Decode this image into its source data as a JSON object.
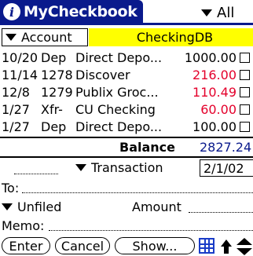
{
  "title_bar": {
    "app_title": "MyCheckbook",
    "view_menu_label": "All"
  },
  "account": {
    "trigger_label": "Account",
    "name": "CheckingDB",
    "name_bg": "#ffff00"
  },
  "register": {
    "rows": [
      {
        "date": "10/20",
        "num": "Dep",
        "desc": "Direct Depo...",
        "amount": "1000.00",
        "amount_color": "black"
      },
      {
        "date": "11/14",
        "num": "1278",
        "desc": "Discover",
        "amount": "216.00",
        "amount_color": "red"
      },
      {
        "date": "12/8",
        "num": "1279",
        "desc": "Publix Groc...",
        "amount": "110.49",
        "amount_color": "red"
      },
      {
        "date": "1/27",
        "num": "Xfr-",
        "desc": "CU Checking",
        "amount": "60.00",
        "amount_color": "red"
      },
      {
        "date": "1/27",
        "num": "Dep",
        "desc": "Direct Depo...",
        "amount": "100.00",
        "amount_color": "black"
      }
    ]
  },
  "balance": {
    "label": "Balance",
    "value": "2827.24"
  },
  "entry": {
    "transaction_label": "Transaction",
    "date_value": "2/1/02",
    "to_label": "To:",
    "category_label": "Unfiled",
    "amount_label": "Amount",
    "memo_label": "Memo:"
  },
  "buttons": {
    "enter": "Enter",
    "cancel": "Cancel",
    "show": "Show..."
  },
  "colors": {
    "title_bar": "#0a1a8c",
    "debit_red": "#e4002b",
    "balance_blue": "#0a1a8c",
    "account_highlight": "#ffff00"
  },
  "icons": {
    "info": "info-icon",
    "grid": "grid-icon",
    "up_arrow": "up-arrow-icon",
    "scroll": "scroll-arrows-icon"
  }
}
